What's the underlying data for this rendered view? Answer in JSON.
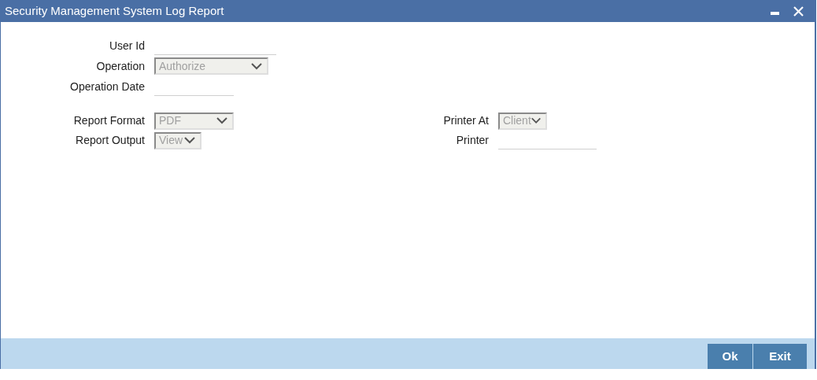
{
  "window": {
    "title": "Security Management System Log Report"
  },
  "criteria_fields": [
    {
      "label": "User Id",
      "kind": "text"
    },
    {
      "label": "Operation",
      "kind": "select",
      "value": "Authorize",
      "disabled": true
    },
    {
      "label": "Operation Date",
      "kind": "text"
    }
  ],
  "report_fields_left": [
    {
      "label": "Report Format",
      "kind": "select",
      "value": "PDF",
      "disabled": true
    },
    {
      "label": "Report Output",
      "kind": "select",
      "value": "View",
      "disabled": true
    }
  ],
  "report_fields_right": [
    {
      "label": "Printer At",
      "kind": "select",
      "value": "Client",
      "disabled": true
    },
    {
      "label": "Printer",
      "kind": "text"
    }
  ],
  "buttons": [
    "Ok",
    "Exit"
  ]
}
